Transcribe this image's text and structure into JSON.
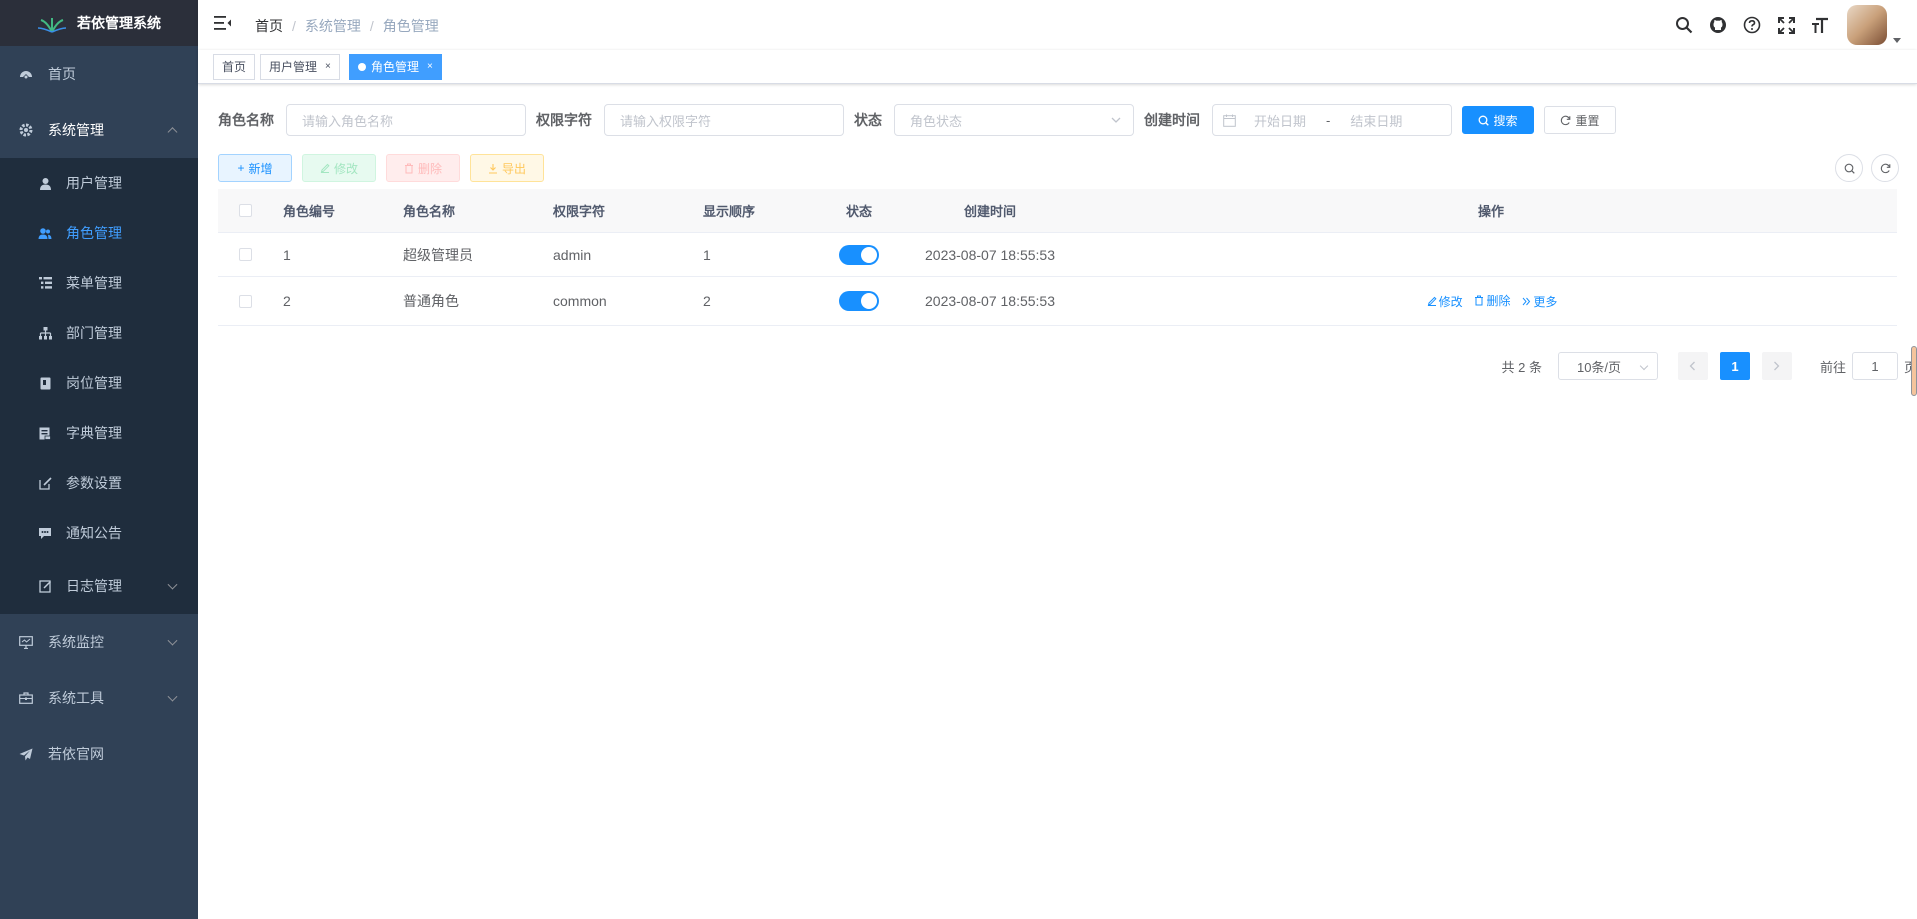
{
  "app": {
    "title": "若依管理系统"
  },
  "sidebar": {
    "home": "首页",
    "system": "系统管理",
    "sub_items": [
      {
        "label": "用户管理"
      },
      {
        "label": "角色管理"
      },
      {
        "label": "菜单管理"
      },
      {
        "label": "部门管理"
      },
      {
        "label": "岗位管理"
      },
      {
        "label": "字典管理"
      },
      {
        "label": "参数设置"
      },
      {
        "label": "通知公告"
      },
      {
        "label": "日志管理"
      }
    ],
    "monitor": "系统监控",
    "tools": "系统工具",
    "website": "若依官网"
  },
  "breadcrumb": [
    "首页",
    "系统管理",
    "角色管理"
  ],
  "tags": [
    {
      "label": "首页"
    },
    {
      "label": "用户管理",
      "close": "×"
    },
    {
      "label": "角色管理",
      "close": "×"
    }
  ],
  "search": {
    "role_name_label": "角色名称",
    "role_name_placeholder": "请输入角色名称",
    "role_key_label": "权限字符",
    "role_key_placeholder": "请输入权限字符",
    "status_label": "状态",
    "status_placeholder": "角色状态",
    "created_label": "创建时间",
    "start_placeholder": "开始日期",
    "range_sep": "-",
    "end_placeholder": "结束日期",
    "search_btn": "搜索",
    "reset_btn": "重置"
  },
  "toolbar": {
    "add": "新增",
    "edit": "修改",
    "delete": "删除",
    "export": "导出"
  },
  "table": {
    "headers": [
      "角色编号",
      "角色名称",
      "权限字符",
      "显示顺序",
      "状态",
      "创建时间",
      "操作"
    ],
    "rows": [
      {
        "id": "1",
        "name": "超级管理员",
        "key": "admin",
        "sort": "1",
        "status_on": true,
        "created": "2023-08-07 18:55:53"
      },
      {
        "id": "2",
        "name": "普通角色",
        "key": "common",
        "sort": "2",
        "status_on": true,
        "created": "2023-08-07 18:55:53",
        "ops": [
          "修改",
          "删除",
          "更多"
        ]
      }
    ]
  },
  "pagination": {
    "total": "共 2 条",
    "size": "10条/页",
    "current": "1",
    "goto_prefix": "前往",
    "goto_value": "1",
    "goto_suffix": "页"
  },
  "colors": {
    "sidebar_bg": "#304156",
    "submenu_bg": "#1f2d3d",
    "primary": "#1890ff",
    "active_text": "#409eff"
  }
}
